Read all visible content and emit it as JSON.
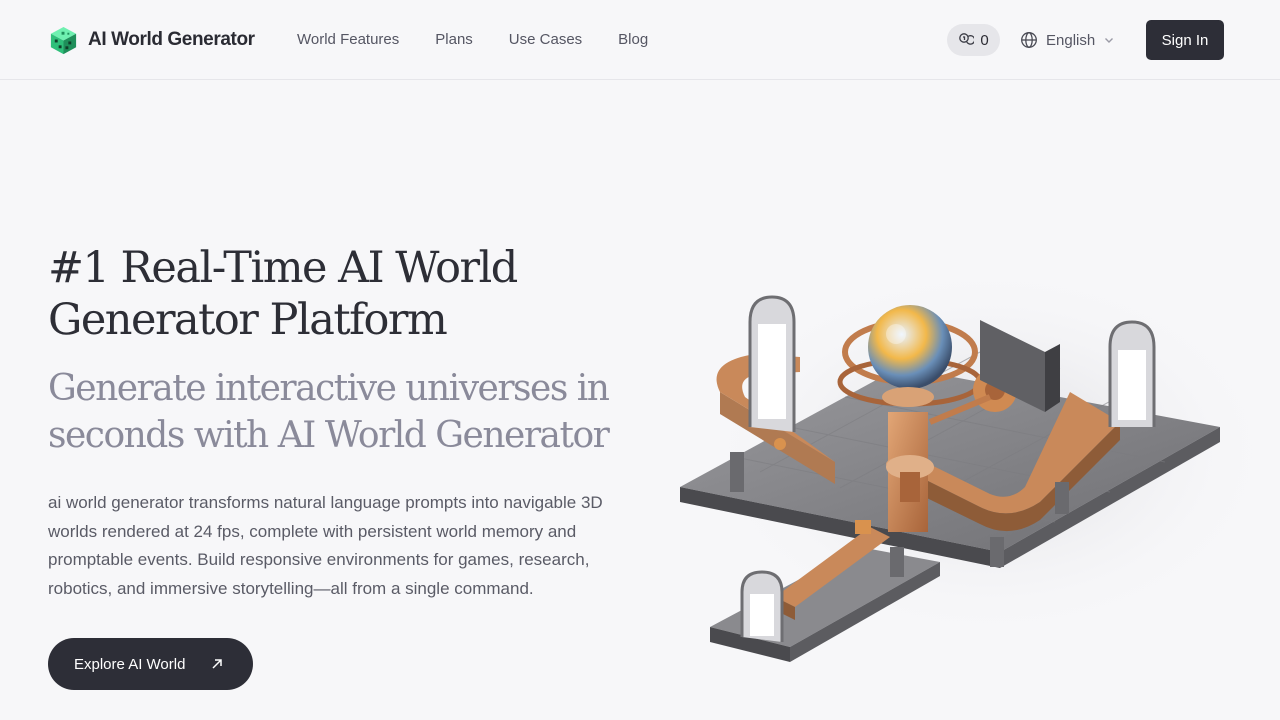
{
  "header": {
    "brand_name": "AI World Generator",
    "nav": {
      "features": "World Features",
      "plans": "Plans",
      "use_cases": "Use Cases",
      "blog": "Blog"
    },
    "credits": "0",
    "language": "English",
    "signin_label": "Sign In"
  },
  "hero": {
    "title_line1": "#1 Real-Time AI World",
    "title_line2": "Generator Platform",
    "subtitle_line1": "Generate interactive universes in",
    "subtitle_line2": "seconds with AI World Generator",
    "body": "ai world generator transforms natural language prompts into navigable 3D worlds rendered at 24 fps, complete with persistent world memory and promptable events. Build responsive environments for games, research, robotics, and immersive storytelling—all from a single command.",
    "cta_label": "Explore AI World"
  },
  "icons": {
    "logo": "green-cube-logo",
    "credits": "coins-icon",
    "language": "globe-icon",
    "language_caret": "chevron-down-icon",
    "cta": "arrow-up-right-icon"
  },
  "colors": {
    "background": "#f7f7f9",
    "primary_dark": "#2d2e37",
    "muted_text": "#8a8a9a",
    "brand_green": "#3ecf8e",
    "illustration_copper": "#c9895a"
  }
}
